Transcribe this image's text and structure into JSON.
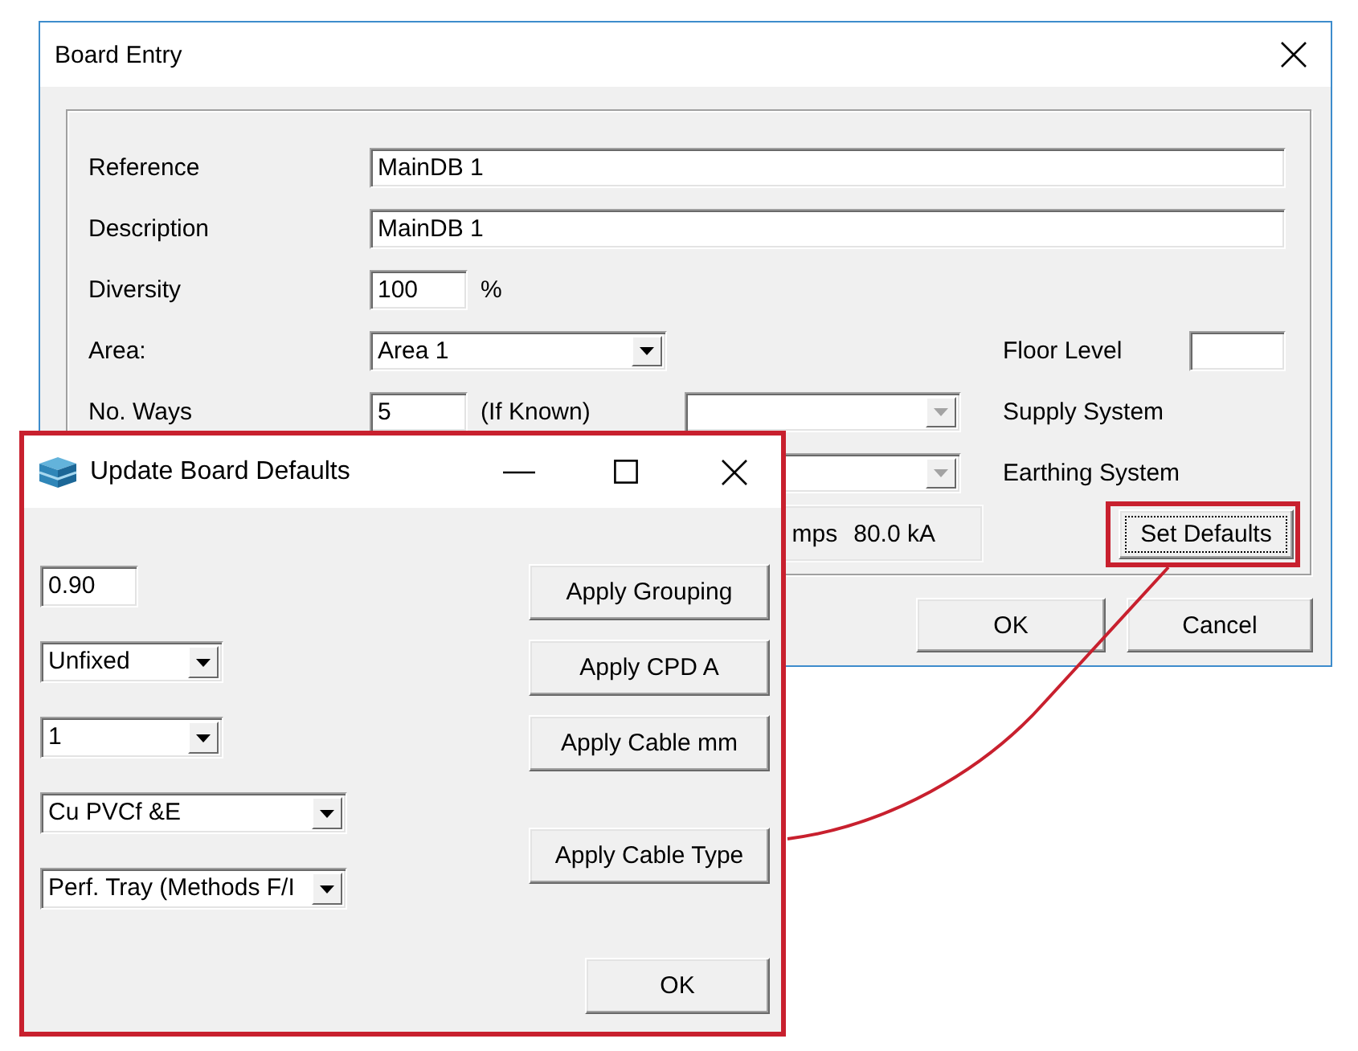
{
  "board_entry": {
    "title": "Board Entry",
    "fields": [
      {
        "kind": "wide",
        "label": "Reference",
        "value": "MainDB 1",
        "disabled": false
      },
      {
        "kind": "wide",
        "label": "Description",
        "value": "MainDB 1",
        "disabled": false
      },
      {
        "kind": "short",
        "label": "Diversity",
        "value": "100",
        "suffix": "%",
        "disabled": false
      },
      {
        "kind": "dropdown",
        "label": "Area:",
        "value": "Area 1",
        "disabled": false
      },
      {
        "kind": "short",
        "label": "No. Ways",
        "value": "5",
        "suffix": "(If Known)",
        "disabled": false
      }
    ],
    "floor_level": {
      "label": "Floor Level"
    },
    "systems": [
      {
        "label": "Supply System",
        "disabled": true
      },
      {
        "label": "Earthing System",
        "disabled": true
      }
    ],
    "summary": [
      "mps",
      "80.0 kA"
    ],
    "set_defaults": {
      "label": "Set Defaults",
      "focused": true,
      "highlighted": true
    },
    "buttons": [
      "OK",
      "Cancel"
    ]
  },
  "update_board_defaults": {
    "title": "Update Board Defaults",
    "highlighted": true,
    "inputs": [
      {
        "kind": "text",
        "value": "0.90"
      },
      {
        "kind": "dropdown",
        "value": "Unfixed"
      },
      {
        "kind": "dropdown",
        "value": "1"
      },
      {
        "kind": "dropdown",
        "value": "Cu PVCf &E"
      },
      {
        "kind": "dropdown",
        "value": "Perf. Tray (Methods F/I"
      }
    ],
    "apply_buttons": [
      "Apply Grouping",
      "Apply CPD A",
      "Apply Cable mm",
      "Apply Cable Type"
    ],
    "ok_button": "OK"
  }
}
